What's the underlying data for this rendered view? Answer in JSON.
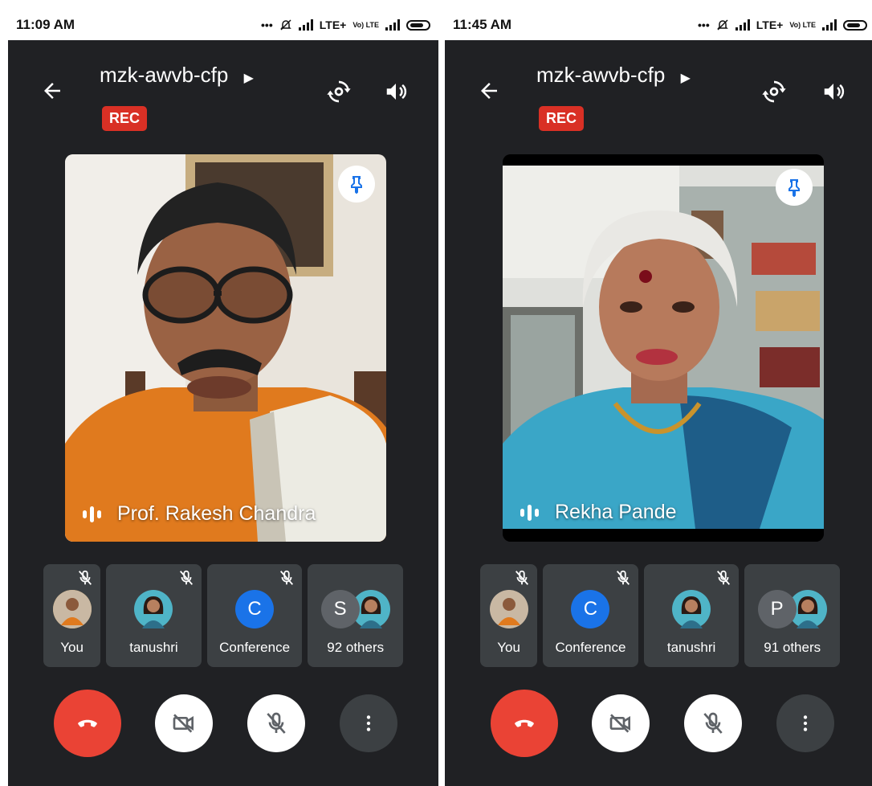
{
  "screens": [
    {
      "status": {
        "time": "11:09 AM",
        "network": "LTE+",
        "volte": "Vo) LTE"
      },
      "header": {
        "meeting_code": "mzk-awvb-cfp",
        "rec_label": "REC"
      },
      "main_tile": {
        "name": "Prof. Rakesh Chandra"
      },
      "participants": [
        {
          "label": "You",
          "type": "photo"
        },
        {
          "label": "tanushri",
          "type": "photo"
        },
        {
          "label": "Conference",
          "type": "initial",
          "initial": "C",
          "color": "#1a73e8"
        },
        {
          "label": "92 others",
          "type": "group",
          "initial": "S",
          "color": "#5f6368"
        }
      ]
    },
    {
      "status": {
        "time": "11:45 AM",
        "network": "LTE+",
        "volte": "Vo) LTE"
      },
      "header": {
        "meeting_code": "mzk-awvb-cfp",
        "rec_label": "REC"
      },
      "main_tile": {
        "name": "Rekha Pande"
      },
      "participants": [
        {
          "label": "You",
          "type": "photo"
        },
        {
          "label": "Conference",
          "type": "initial",
          "initial": "C",
          "color": "#1a73e8"
        },
        {
          "label": "tanushri",
          "type": "photo"
        },
        {
          "label": "91 others",
          "type": "group",
          "initial": "P",
          "color": "#5f6368"
        }
      ]
    }
  ],
  "colors": {
    "background": "#202124",
    "card": "#3c4043",
    "end_call": "#ea4335",
    "rec": "#d93025",
    "accent": "#1a73e8"
  },
  "icons": [
    "back-arrow-icon",
    "switch-camera-icon",
    "speaker-icon",
    "pin-icon",
    "speaking-bars-icon",
    "mic-off-icon",
    "end-call-icon",
    "camera-off-icon",
    "more-vert-icon"
  ]
}
